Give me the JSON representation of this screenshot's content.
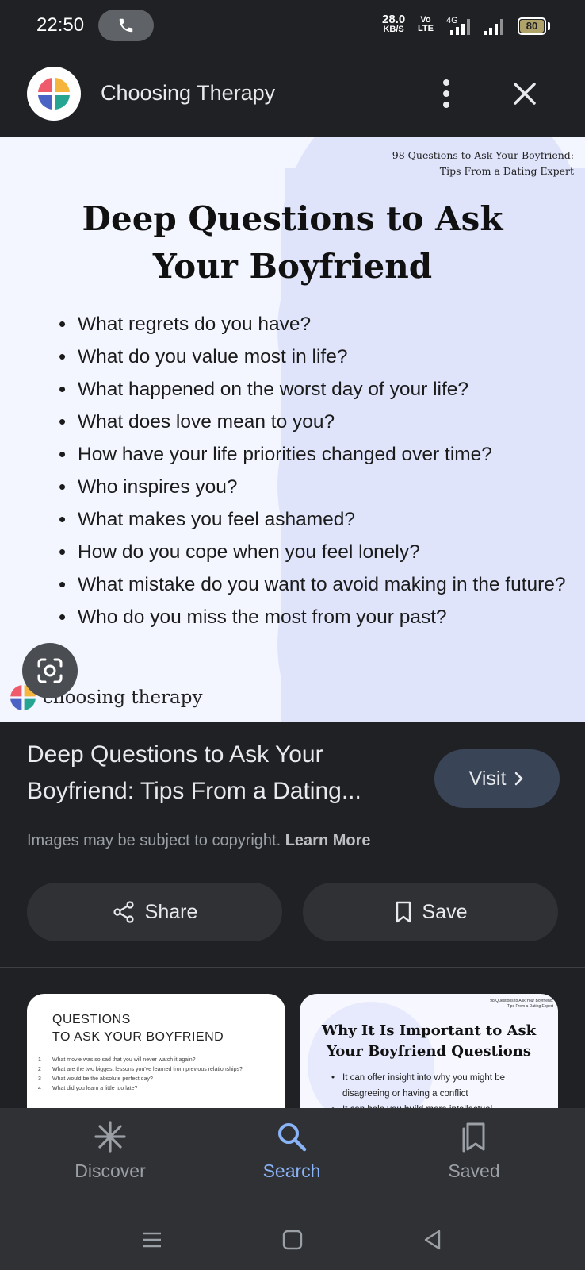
{
  "status_bar": {
    "time": "22:50",
    "net_speed_value": "28.0",
    "net_speed_unit": "KB/S",
    "volte_top": "Vo",
    "volte_bottom": "LTE",
    "network": "4G",
    "battery": "80"
  },
  "header": {
    "site_name": "Choosing Therapy",
    "icons": [
      "choosing-therapy-logo",
      "more-vert-icon",
      "close-icon"
    ]
  },
  "image": {
    "source_line_1": "98 Questions to Ask Your Boyfriend:",
    "source_line_2": "Tips From a Dating Expert",
    "title_line_1": "Deep Questions to Ask",
    "title_line_2": "Your Boyfriend",
    "questions": [
      "What regrets do you have?",
      "What do you value most in life?",
      "What happened on the worst day of your life?",
      "What does love mean to you?",
      "How have your life priorities changed over time?",
      "Who inspires you?",
      "What makes you feel ashamed?",
      "How do you cope when you feel lonely?",
      "What mistake do you want to avoid making in the future?",
      "Who do you miss the most from your past?"
    ],
    "brand": "choosing therapy",
    "accent_colors": [
      "#ef5b6b",
      "#f6b63e",
      "#4a63c4",
      "#27a593"
    ]
  },
  "result": {
    "title": "Deep Questions to Ask Your Boyfriend: Tips From a Dating...",
    "visit_label": "Visit",
    "copyright_text": "Images may be subject to copyright.",
    "learn_more_label": "Learn More",
    "share_label": "Share",
    "save_label": "Save"
  },
  "related": {
    "left": {
      "title_line_1": "QUESTIONS",
      "title_line_2": "TO ASK YOUR BOYFRIEND",
      "items": [
        {
          "n": "1",
          "text": "What movie was so sad that you will never watch it again?"
        },
        {
          "n": "2",
          "text": "What are the two biggest lessons you've learned from previous relationships?"
        },
        {
          "n": "3",
          "text": "What would be the absolute perfect day?"
        },
        {
          "n": "4",
          "text": "What did you learn a little too late?"
        }
      ]
    },
    "right": {
      "source_line_1": "98 Questions to Ask Your Boyfriend:",
      "source_line_2": "Tips From a Dating Expert",
      "title_line_1": "Why It Is Important to Ask",
      "title_line_2": "Your Boyfriend Questions",
      "items": [
        "It can offer insight into why you might be disagreeing or having a conflict",
        "It can help you build more intellectual"
      ]
    }
  },
  "bottom_nav": {
    "discover_label": "Discover",
    "search_label": "Search",
    "saved_label": "Saved",
    "active": "Search",
    "active_color": "#8ab4f8"
  }
}
